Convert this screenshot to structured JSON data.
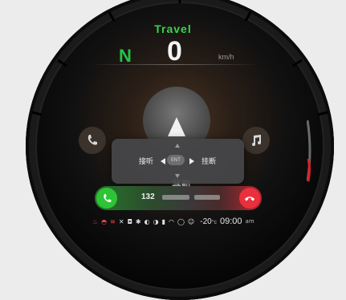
{
  "cluster": {
    "mode": "Travel",
    "gear": "N",
    "speed": "0",
    "speed_unit": "km/h"
  },
  "navigation": {
    "label": "导航"
  },
  "incoming_call_popup": {
    "answer_label": "接听",
    "center_key": "ENT",
    "hangup_label": "挂断"
  },
  "call_bar": {
    "number_visible": "132"
  },
  "status_bar": {
    "icons": [
      "seat-heat-icon",
      "steering-heat-icon",
      "seat-ventilation-icon",
      "mute-icon",
      "lock-icon",
      "bluetooth-icon",
      "headlight-icon",
      "fog-light-icon",
      "signal-bars-icon",
      "wifi-icon",
      "tire-pressure-icon",
      "smile-icon"
    ],
    "temperature": "-20",
    "temperature_unit": "°c",
    "time": "09:00",
    "ampm": "am"
  },
  "colors": {
    "accept": "#2ec436",
    "reject": "#ea2f3d",
    "mode_green": "#3ad34f"
  }
}
